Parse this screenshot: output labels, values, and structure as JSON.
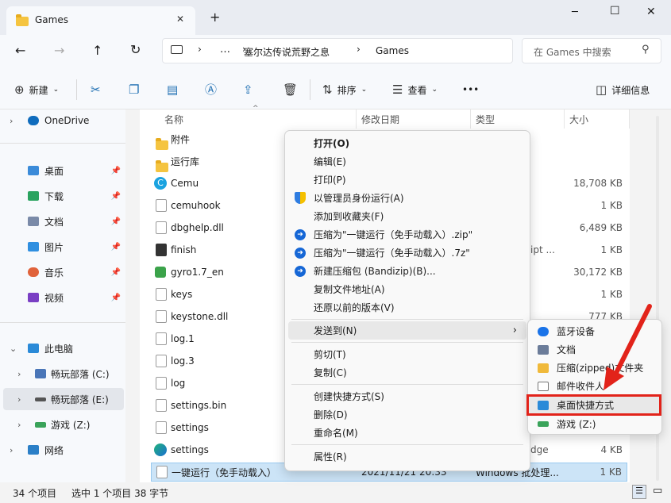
{
  "window": {
    "tab_title": "Games",
    "new_tab": "+",
    "minimize": "─",
    "maximize": "☐",
    "close": "✕",
    "tab_close": "✕"
  },
  "nav": {
    "back": "←",
    "forward": "→",
    "up": "↑",
    "refresh": "↻",
    "more_crumbs": "…",
    "crumbs": [
      "塞尔达传说荒野之息",
      "Games"
    ],
    "search_placeholder": "在 Games 中搜索"
  },
  "toolbar": {
    "new": "新建",
    "sort": "排序",
    "view": "查看",
    "more": "•••",
    "details": "详细信息"
  },
  "sidebar": {
    "items": [
      {
        "label": "OneDrive",
        "level": 0
      },
      {
        "label": "桌面",
        "pinned": true
      },
      {
        "label": "下载",
        "pinned": true
      },
      {
        "label": "文档",
        "pinned": true
      },
      {
        "label": "图片",
        "pinned": true
      },
      {
        "label": "音乐",
        "pinned": true
      },
      {
        "label": "视频",
        "pinned": true
      },
      {
        "label": "此电脑"
      },
      {
        "label": "畅玩部落 (C:)"
      },
      {
        "label": "畅玩部落 (E:)",
        "selected": true
      },
      {
        "label": "游戏 (Z:)"
      },
      {
        "label": "网络"
      }
    ]
  },
  "columns": {
    "name": "名称",
    "date": "修改日期",
    "type": "类型",
    "size": "大小"
  },
  "files": [
    {
      "name": "附件",
      "size": "",
      "kind": "folder"
    },
    {
      "name": "运行库",
      "size": "",
      "kind": "folder"
    },
    {
      "name": "Cemu",
      "size": "18,708 KB",
      "kind": "exe"
    },
    {
      "name": "cemuhook",
      "size": "1 KB",
      "kind": "file"
    },
    {
      "name": "dbghelp.dll",
      "size": "6,489 KB",
      "kind": "file"
    },
    {
      "name": "finish",
      "size": "1 KB",
      "kind": "file"
    },
    {
      "name": "gyro1.7_en",
      "size": "30,172 KB",
      "kind": "exe"
    },
    {
      "name": "keys",
      "size": "1 KB",
      "kind": "file"
    },
    {
      "name": "keystone.dll",
      "size": "777 KB",
      "kind": "file"
    },
    {
      "name": "log.1",
      "size": "",
      "kind": "file"
    },
    {
      "name": "log.3",
      "size": "",
      "kind": "file"
    },
    {
      "name": "log",
      "size": "",
      "kind": "file"
    },
    {
      "name": "settings.bin",
      "size": "",
      "kind": "file"
    },
    {
      "name": "settings",
      "size": "",
      "kind": "file"
    },
    {
      "name": "settings",
      "size": "4 KB",
      "kind": "edge"
    },
    {
      "name": "一键运行（免手动载入）",
      "date": "2021/11/21 20:33",
      "type": "Windows 批处理...",
      "size": "1 KB",
      "kind": "bat",
      "selected": true
    }
  ],
  "peek": {
    "ipt": "ipt ...",
    "dge": "dge"
  },
  "context_menu": {
    "items": [
      {
        "label": "打开(O)",
        "bold": true
      },
      {
        "label": "编辑(E)"
      },
      {
        "label": "打印(P)"
      },
      {
        "label": "以管理员身份运行(A)",
        "icon": "shield-icon"
      },
      {
        "label": "添加到收藏夹(F)"
      },
      {
        "label": "压缩为\"一键运行（免手动载入）.zip\"",
        "icon": "bandizip-icon"
      },
      {
        "label": "压缩为\"一键运行（免手动载入）.7z\"",
        "icon": "bandizip-icon"
      },
      {
        "label": "新建压缩包 (Bandizip)(B)...",
        "icon": "bandizip-icon"
      },
      {
        "label": "复制文件地址(A)"
      },
      {
        "label": "还原以前的版本(V)"
      },
      {
        "label": "发送到(N)",
        "submenu": true
      },
      {
        "label": "剪切(T)"
      },
      {
        "label": "复制(C)"
      },
      {
        "label": "创建快捷方式(S)"
      },
      {
        "label": "删除(D)"
      },
      {
        "label": "重命名(M)"
      },
      {
        "label": "属性(R)"
      }
    ],
    "arrow": "›"
  },
  "send_to": {
    "items": [
      {
        "label": "蓝牙设备"
      },
      {
        "label": "文档"
      },
      {
        "label": "压缩(zipped)文件夹"
      },
      {
        "label": "邮件收件人"
      },
      {
        "label": "桌面快捷方式",
        "highlighted": true
      },
      {
        "label": "游戏 (Z:)"
      }
    ]
  },
  "status": {
    "count": "34 个项目",
    "selection": "选中 1 个项目  38 字节"
  },
  "colors": {
    "accent": "#005fb8",
    "highlight_box": "#e2231a",
    "arrow": "#e2231a"
  }
}
